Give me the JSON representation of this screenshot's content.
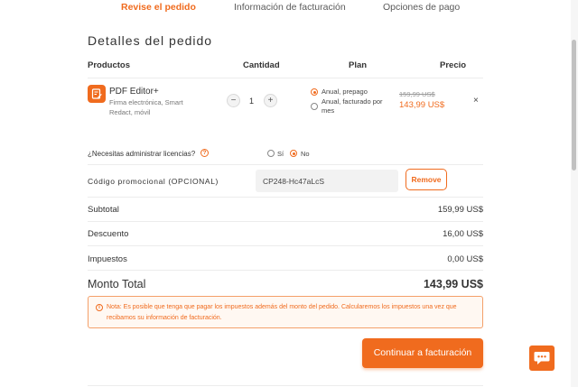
{
  "steps": [
    {
      "label": "Revise el pedido",
      "active": true
    },
    {
      "label": "Información de facturación",
      "active": false
    },
    {
      "label": "Opciones de pago",
      "active": false
    }
  ],
  "section_title": "Detalles del pedido",
  "table_headers": {
    "products": "Productos",
    "quantity": "Cantidad",
    "plan": "Plan",
    "price": "Precio"
  },
  "product": {
    "icon": "document-edit-icon",
    "name": "PDF Editor+",
    "description": "Firma electrónica, Smart Redact, móvil",
    "quantity": "1",
    "minus": "−",
    "plus": "+",
    "plans": [
      {
        "label": "Anual, prepago",
        "selected": true
      },
      {
        "label": "Anual, facturado por mes",
        "selected": false
      }
    ],
    "old_price": "159,99 US$",
    "new_price": "143,99 US$",
    "remove": "×"
  },
  "licenses": {
    "question": "¿Necesitas administrar licencias?",
    "help": "?",
    "yes": "Sí",
    "no": "No",
    "selected": "No"
  },
  "promo": {
    "label": "Código promocional (OPCIONAL)",
    "value": "CP248-Hc47aLcS",
    "remove_label": "Remove"
  },
  "summary": [
    {
      "label": "Subtotal",
      "value": "159,99 US$"
    },
    {
      "label": "Descuento",
      "value": "16,00 US$"
    },
    {
      "label": "Impuestos",
      "value": "0,00 US$"
    }
  ],
  "total": {
    "label": "Monto Total",
    "value": "143,99 US$"
  },
  "note": {
    "icon": "i",
    "text": "Nota: Es posible que tenga que pagar los impuestos además del monto del pedido. Calcularemos los impuestos una vez que recibamos su información de facturación."
  },
  "cta_label": "Continuar a facturación",
  "colors": {
    "accent": "#f06b1e"
  }
}
